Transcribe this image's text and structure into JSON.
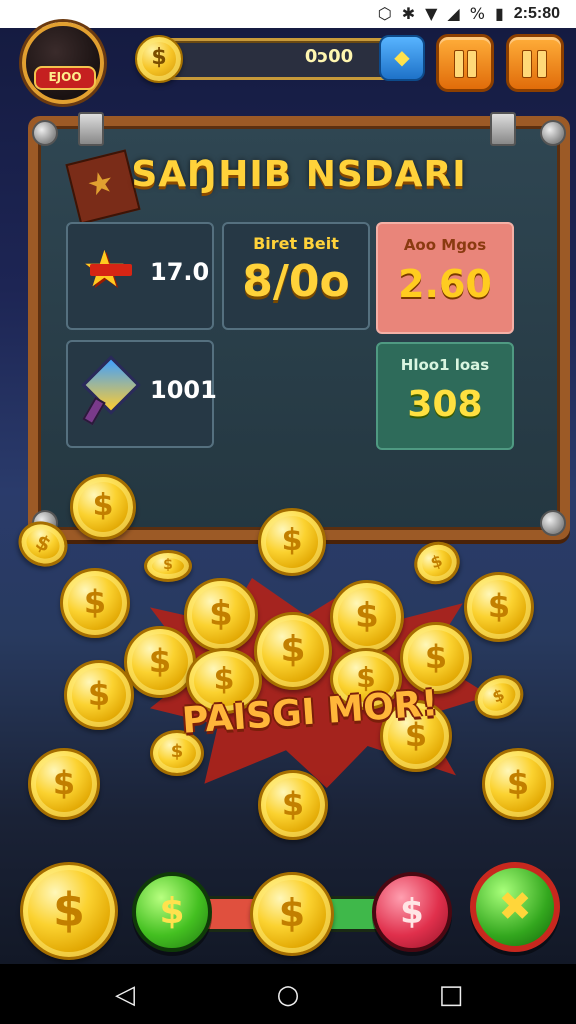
{
  "status_bar": {
    "time": "2:5:80",
    "battery_text": "%",
    "icons": [
      "hexagon-icon",
      "bluetooth-icon",
      "wifi-icon",
      "signal-icon",
      "battery-icon"
    ]
  },
  "hud": {
    "avatar_label": "EJOO",
    "coin_symbol": "$",
    "coin_amount": "0ɔ00",
    "plus_icon": "fish-icon",
    "pause_icon": "pause-icon",
    "menu_icon": "pause-icon"
  },
  "board": {
    "title": "SAŊHIB NSDARI",
    "left_top_value": "17.0",
    "left_bottom_value": "1001",
    "center_label": "Biret Beit",
    "center_value": "8/0o",
    "red_label": "Aoo Mgos",
    "red_value": "2.60",
    "green_label": "Hloo1 loas",
    "green_value": "308"
  },
  "banner": {
    "text": "PAISGI MOR!"
  },
  "coin_glyph": "$",
  "controls": {
    "left_coin": "$",
    "green_button": "$",
    "center_coin": "$",
    "red_button": "$",
    "x_button": "x-icon"
  },
  "nav": {
    "back": "◁",
    "home": "○",
    "recent": "□"
  },
  "colors": {
    "accent_gold": "#ffd23a",
    "red": "#e0304c",
    "green": "#44c021",
    "wood": "#9c5a26"
  }
}
